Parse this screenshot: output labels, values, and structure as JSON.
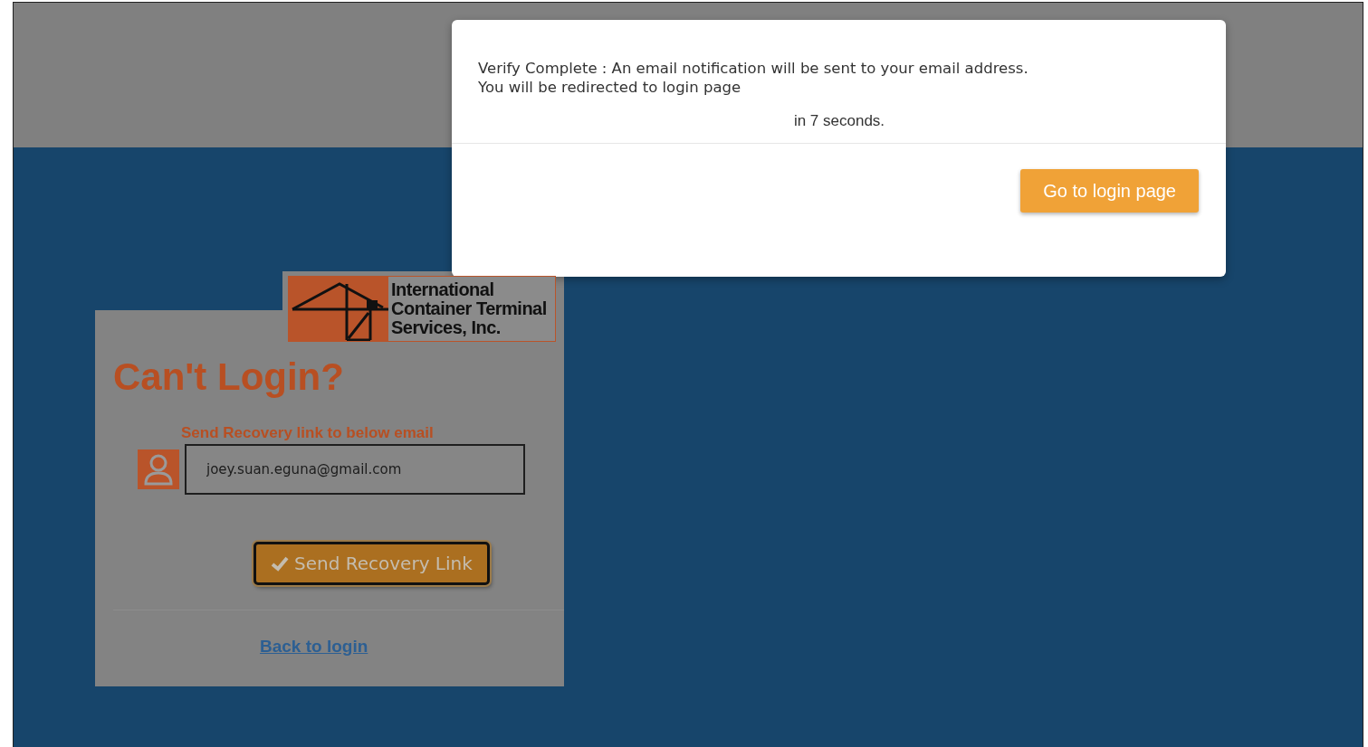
{
  "modal": {
    "message_lines": [
      "Verify Complete : An email notification will be sent to your email address.",
      "You will be redirected to login page"
    ],
    "countdown": "in 7 seconds.",
    "button": "Go to login page"
  },
  "logo": {
    "lines": [
      "International",
      "Container Terminal",
      "Services, Inc."
    ]
  },
  "card": {
    "title": "Can't Login?",
    "prompt": "Send Recovery link to below email",
    "email": {
      "value": "joey.suan.eguna@gmail.com"
    },
    "button": "Send Recovery Link",
    "link": "Back to login"
  }
}
